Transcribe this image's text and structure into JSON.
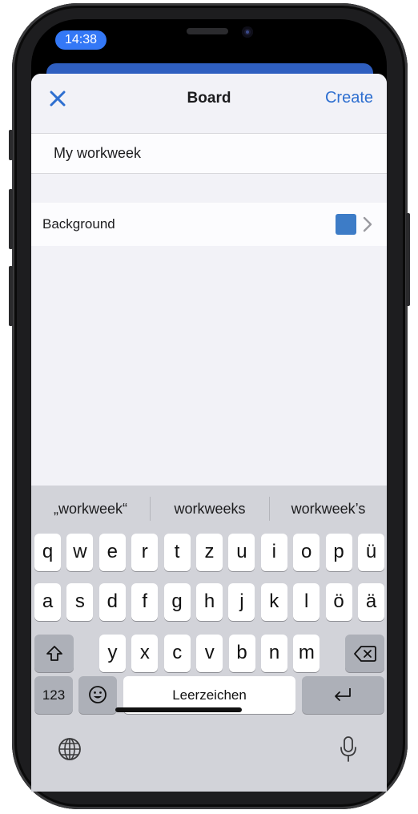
{
  "status_bar": {
    "time": "14:38"
  },
  "sheet": {
    "title": "Board",
    "close_icon": "close-icon",
    "create_label": "Create",
    "name_value": "My workweek",
    "background_label": "Background",
    "background_color": "#3d7cc7"
  },
  "keyboard": {
    "suggestions": [
      "„workweek“",
      "workweeks",
      "workweek’s"
    ],
    "row1": [
      "q",
      "w",
      "e",
      "r",
      "t",
      "z",
      "u",
      "i",
      "o",
      "p",
      "ü"
    ],
    "row2": [
      "a",
      "s",
      "d",
      "f",
      "g",
      "h",
      "j",
      "k",
      "l",
      "ö",
      "ä"
    ],
    "row3": [
      "y",
      "x",
      "c",
      "v",
      "b",
      "n",
      "m"
    ],
    "numbers_label": "123",
    "space_label": "Leerzeichen",
    "shift_icon": "shift-icon",
    "delete_icon": "delete-icon",
    "emoji_icon": "emoji-icon",
    "return_icon": "return-icon",
    "globe_icon": "globe-icon",
    "mic_icon": "microphone-icon"
  }
}
